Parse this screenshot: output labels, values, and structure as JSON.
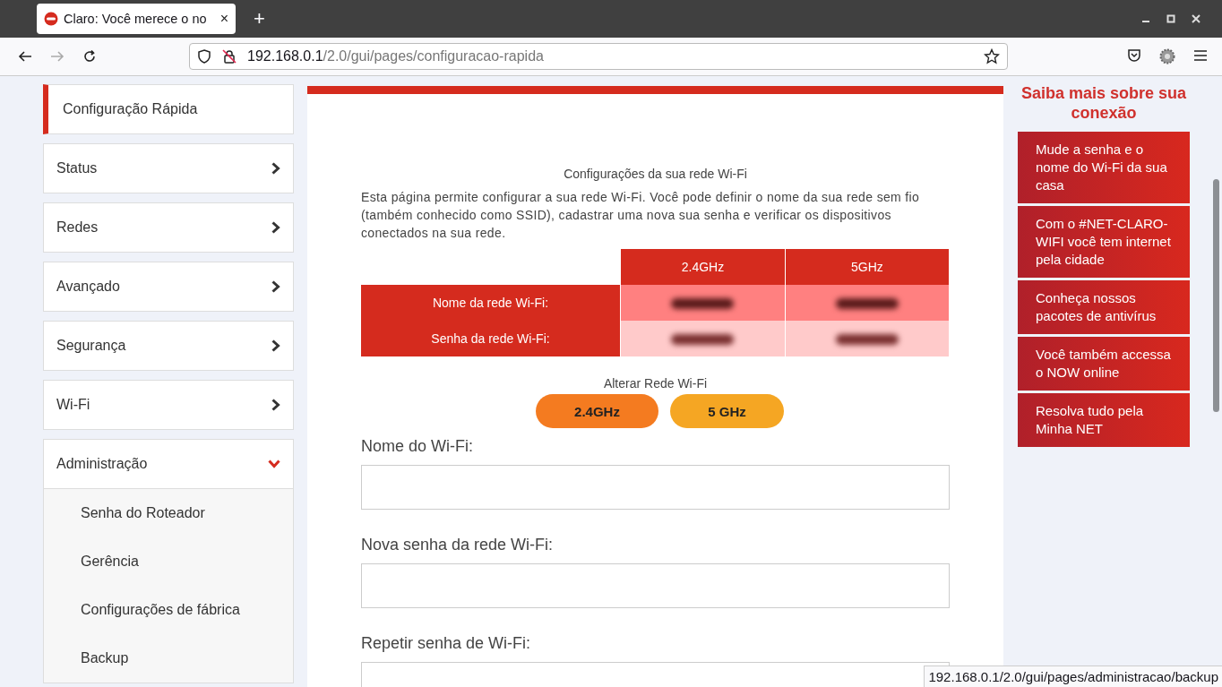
{
  "browser": {
    "tab": {
      "title": "Claro: Você merece o no",
      "close": "×",
      "selected": true
    },
    "new_tab": "+",
    "nav": {
      "forward_disabled": true
    },
    "url": {
      "host": "192.168.0.1",
      "path": "/2.0/gui/pages/configuracao-rapida"
    }
  },
  "sidebar": {
    "items": [
      {
        "label": "Configuração Rápida",
        "kind": "link",
        "selected": true
      },
      {
        "label": "Status",
        "kind": "group",
        "selected": false,
        "expanded": false
      },
      {
        "label": "Redes",
        "kind": "group",
        "selected": false,
        "expanded": false
      },
      {
        "label": "Avançado",
        "kind": "group",
        "selected": false,
        "expanded": false
      },
      {
        "label": "Segurança",
        "kind": "group",
        "selected": false,
        "expanded": false
      },
      {
        "label": "Wi-Fi",
        "kind": "group",
        "selected": false,
        "expanded": false
      },
      {
        "label": "Administração",
        "kind": "group",
        "selected": false,
        "expanded": true,
        "children": [
          {
            "label": "Senha do Roteador"
          },
          {
            "label": "Gerência"
          },
          {
            "label": "Configurações de fábrica"
          },
          {
            "label": "Backup"
          }
        ]
      }
    ]
  },
  "main": {
    "title": "Configurações da sua rede Wi-Fi",
    "description": "Esta página permite configurar a sua rede Wi-Fi. Você pode definir o nome da sua rede sem fio (também conhecido como SSID), cadastrar uma nova sua senha e verificar os dispositivos conectados na sua rede.",
    "table": {
      "columns": [
        "2.4GHz",
        "5GHz"
      ],
      "rows": [
        {
          "label": "Nome da rede Wi-Fi:"
        },
        {
          "label": "Senha da rede Wi-Fi:"
        }
      ]
    },
    "switch": {
      "label": "Alterar Rede Wi-Fi",
      "buttons": [
        {
          "label": "2.4GHz",
          "selected": true
        },
        {
          "label": "5 GHz",
          "selected": false
        }
      ]
    },
    "fields": [
      {
        "label": "Nome do Wi-Fi:"
      },
      {
        "label": "Nova senha da rede Wi-Fi:"
      },
      {
        "label": "Repetir senha de Wi-Fi:"
      }
    ]
  },
  "aside": {
    "title": "Saiba mais sobre sua conexão",
    "links": [
      "Mude a senha e o nome do Wi-Fi da sua casa",
      "Com o #NET-CLARO-WIFI você tem internet pela cidade",
      "Conheça nossos pacotes de antivírus",
      "Você também accessa o NOW online",
      "Resolva tudo pela Minha NET"
    ]
  },
  "status_tip": "192.168.0.1/2.0/gui/pages/administracao/backup"
}
